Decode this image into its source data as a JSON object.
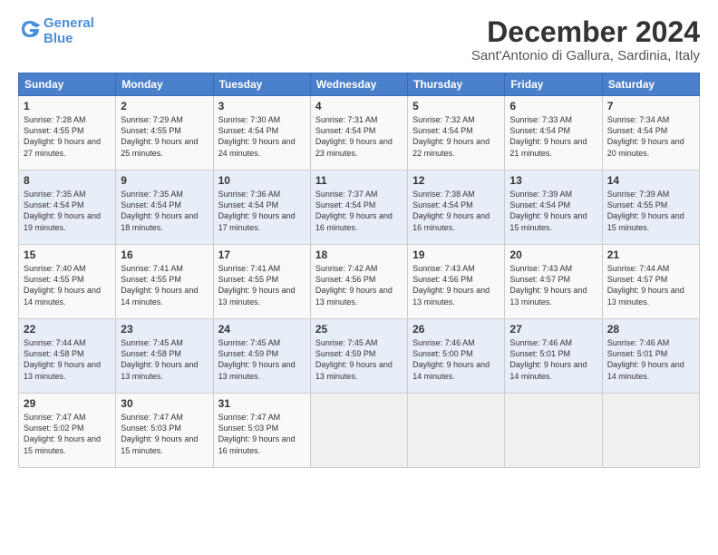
{
  "logo": {
    "line1": "General",
    "line2": "Blue"
  },
  "title": "December 2024",
  "location": "Sant'Antonio di Gallura, Sardinia, Italy",
  "days_of_week": [
    "Sunday",
    "Monday",
    "Tuesday",
    "Wednesday",
    "Thursday",
    "Friday",
    "Saturday"
  ],
  "weeks": [
    [
      {
        "day": "1",
        "sunrise": "7:28 AM",
        "sunset": "4:55 PM",
        "daylight": "9 hours and 27 minutes."
      },
      {
        "day": "2",
        "sunrise": "7:29 AM",
        "sunset": "4:55 PM",
        "daylight": "9 hours and 25 minutes."
      },
      {
        "day": "3",
        "sunrise": "7:30 AM",
        "sunset": "4:54 PM",
        "daylight": "9 hours and 24 minutes."
      },
      {
        "day": "4",
        "sunrise": "7:31 AM",
        "sunset": "4:54 PM",
        "daylight": "9 hours and 23 minutes."
      },
      {
        "day": "5",
        "sunrise": "7:32 AM",
        "sunset": "4:54 PM",
        "daylight": "9 hours and 22 minutes."
      },
      {
        "day": "6",
        "sunrise": "7:33 AM",
        "sunset": "4:54 PM",
        "daylight": "9 hours and 21 minutes."
      },
      {
        "day": "7",
        "sunrise": "7:34 AM",
        "sunset": "4:54 PM",
        "daylight": "9 hours and 20 minutes."
      }
    ],
    [
      {
        "day": "8",
        "sunrise": "7:35 AM",
        "sunset": "4:54 PM",
        "daylight": "9 hours and 19 minutes."
      },
      {
        "day": "9",
        "sunrise": "7:35 AM",
        "sunset": "4:54 PM",
        "daylight": "9 hours and 18 minutes."
      },
      {
        "day": "10",
        "sunrise": "7:36 AM",
        "sunset": "4:54 PM",
        "daylight": "9 hours and 17 minutes."
      },
      {
        "day": "11",
        "sunrise": "7:37 AM",
        "sunset": "4:54 PM",
        "daylight": "9 hours and 16 minutes."
      },
      {
        "day": "12",
        "sunrise": "7:38 AM",
        "sunset": "4:54 PM",
        "daylight": "9 hours and 16 minutes."
      },
      {
        "day": "13",
        "sunrise": "7:39 AM",
        "sunset": "4:54 PM",
        "daylight": "9 hours and 15 minutes."
      },
      {
        "day": "14",
        "sunrise": "7:39 AM",
        "sunset": "4:55 PM",
        "daylight": "9 hours and 15 minutes."
      }
    ],
    [
      {
        "day": "15",
        "sunrise": "7:40 AM",
        "sunset": "4:55 PM",
        "daylight": "9 hours and 14 minutes."
      },
      {
        "day": "16",
        "sunrise": "7:41 AM",
        "sunset": "4:55 PM",
        "daylight": "9 hours and 14 minutes."
      },
      {
        "day": "17",
        "sunrise": "7:41 AM",
        "sunset": "4:55 PM",
        "daylight": "9 hours and 13 minutes."
      },
      {
        "day": "18",
        "sunrise": "7:42 AM",
        "sunset": "4:56 PM",
        "daylight": "9 hours and 13 minutes."
      },
      {
        "day": "19",
        "sunrise": "7:43 AM",
        "sunset": "4:56 PM",
        "daylight": "9 hours and 13 minutes."
      },
      {
        "day": "20",
        "sunrise": "7:43 AM",
        "sunset": "4:57 PM",
        "daylight": "9 hours and 13 minutes."
      },
      {
        "day": "21",
        "sunrise": "7:44 AM",
        "sunset": "4:57 PM",
        "daylight": "9 hours and 13 minutes."
      }
    ],
    [
      {
        "day": "22",
        "sunrise": "7:44 AM",
        "sunset": "4:58 PM",
        "daylight": "9 hours and 13 minutes."
      },
      {
        "day": "23",
        "sunrise": "7:45 AM",
        "sunset": "4:58 PM",
        "daylight": "9 hours and 13 minutes."
      },
      {
        "day": "24",
        "sunrise": "7:45 AM",
        "sunset": "4:59 PM",
        "daylight": "9 hours and 13 minutes."
      },
      {
        "day": "25",
        "sunrise": "7:45 AM",
        "sunset": "4:59 PM",
        "daylight": "9 hours and 13 minutes."
      },
      {
        "day": "26",
        "sunrise": "7:46 AM",
        "sunset": "5:00 PM",
        "daylight": "9 hours and 14 minutes."
      },
      {
        "day": "27",
        "sunrise": "7:46 AM",
        "sunset": "5:01 PM",
        "daylight": "9 hours and 14 minutes."
      },
      {
        "day": "28",
        "sunrise": "7:46 AM",
        "sunset": "5:01 PM",
        "daylight": "9 hours and 14 minutes."
      }
    ],
    [
      {
        "day": "29",
        "sunrise": "7:47 AM",
        "sunset": "5:02 PM",
        "daylight": "9 hours and 15 minutes."
      },
      {
        "day": "30",
        "sunrise": "7:47 AM",
        "sunset": "5:03 PM",
        "daylight": "9 hours and 15 minutes."
      },
      {
        "day": "31",
        "sunrise": "7:47 AM",
        "sunset": "5:03 PM",
        "daylight": "9 hours and 16 minutes."
      },
      null,
      null,
      null,
      null
    ]
  ],
  "labels": {
    "sunrise": "Sunrise:",
    "sunset": "Sunset:",
    "daylight": "Daylight:"
  }
}
